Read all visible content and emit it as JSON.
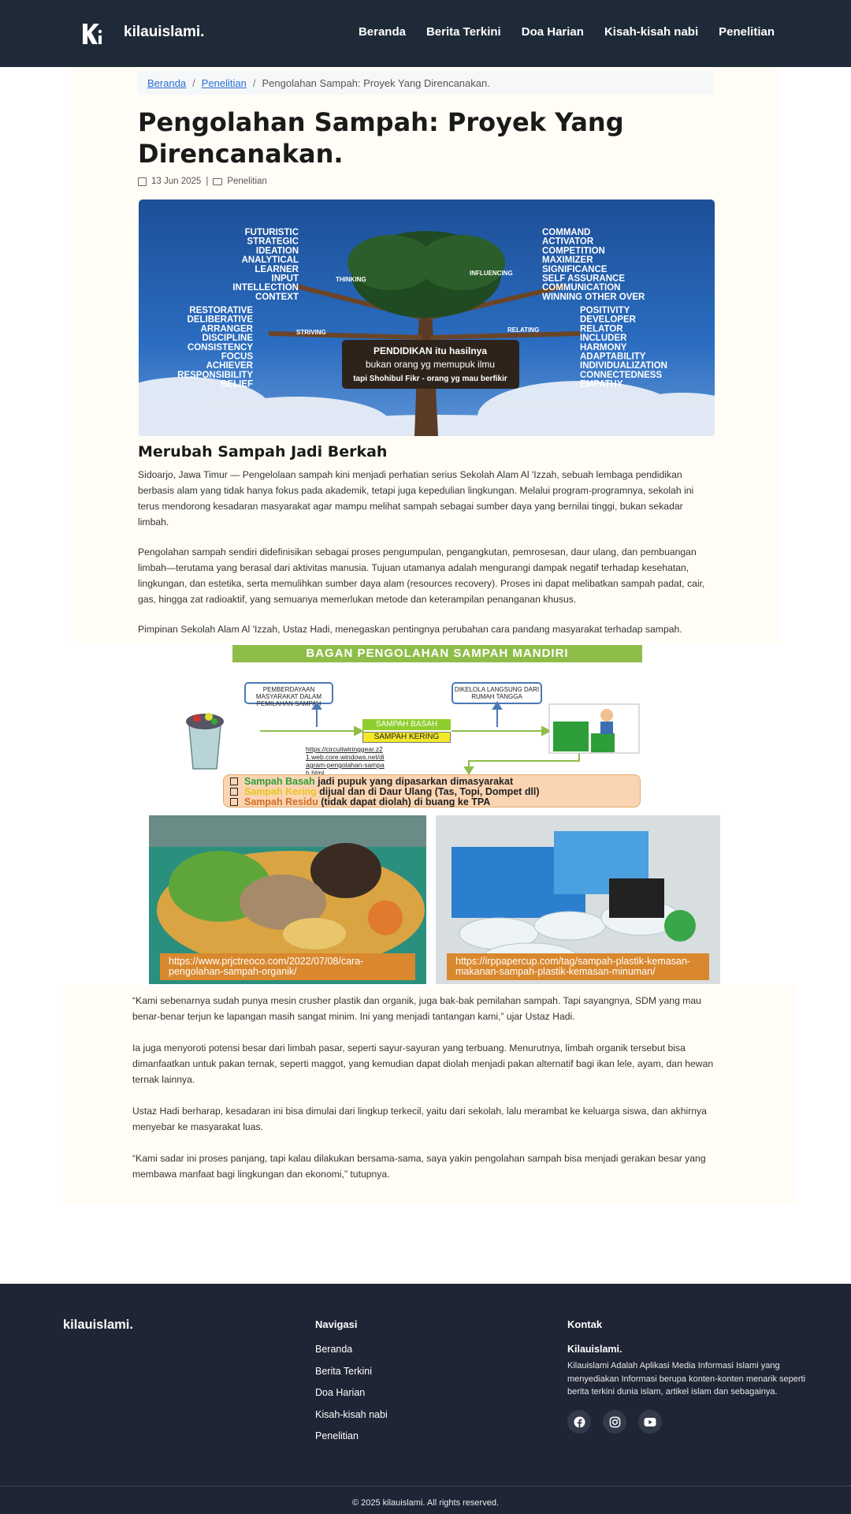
{
  "header": {
    "brand": "kilauislami.",
    "nav": [
      "Beranda",
      "Berita Terkini",
      "Doa Harian",
      "Kisah-kisah nabi",
      "Penelitian"
    ]
  },
  "breadcrumb": {
    "home": "Beranda",
    "category": "Penelitian",
    "current": "Pengolahan Sampah: Proyek Yang Direncanakan."
  },
  "post": {
    "title": "Pengolahan Sampah: Proyek Yang Direncanakan.",
    "date": "13 Jun 2025",
    "meta_sep": "|",
    "category": "Penelitian",
    "hero": {
      "left_words": [
        "FUTURISTIC",
        "STRATEGIC",
        "IDEATION",
        "ANALYTICAL",
        "LEARNER",
        "INPUT",
        "INTELLECTION",
        "CONTEXT"
      ],
      "left_lower_words": [
        "RESTORATIVE",
        "DELIBERATIVE",
        "ARRANGER",
        "DISCIPLINE",
        "CONSISTENCY",
        "FOCUS",
        "ACHIEVER",
        "RESPONSIBILITY",
        "BELIEF"
      ],
      "right_words": [
        "COMMAND",
        "ACTIVATOR",
        "COMPETITION",
        "MAXIMIZER",
        "SIGNIFICANCE",
        "SELF ASSURANCE",
        "COMMUNICATION",
        "WINNING OTHER OVER"
      ],
      "right_lower_words": [
        "POSITIVITY",
        "DEVELOPER",
        "RELATOR",
        "INCLUDER",
        "HARMONY",
        "ADAPTABILITY",
        "INDIVIDUALIZATION",
        "CONNECTEDNESS",
        "EMPATHY"
      ],
      "branch_labels": [
        "THINKING",
        "INFLUENCING",
        "STRIVING",
        "RELATING"
      ],
      "sign_lines": [
        "PENDIDIKAN itu hasilnya",
        "bukan orang yg memupuk ilmu",
        "tapi Shohibul Fikr - orang yg mau berfikir"
      ]
    },
    "section_heading": "Merubah Sampah Jadi Berkah",
    "paragraphs": [
      "Sidoarjo, Jawa Timur — Pengelolaan sampah kini menjadi perhatian serius Sekolah Alam Al 'Izzah, sebuah lembaga pendidikan berbasis alam yang tidak hanya fokus pada akademik, tetapi juga kepedulian lingkungan. Melalui program-programnya, sekolah ini terus mendorong kesadaran masyarakat agar mampu melihat sampah sebagai sumber daya yang bernilai tinggi, bukan sekadar limbah.",
      "Pengolahan sampah sendiri didefinisikan sebagai proses pengumpulan, pengangkutan, pemrosesan, daur ulang, dan pembuangan limbah—terutama yang berasal dari aktivitas manusia. Tujuan utamanya adalah mengurangi dampak negatif terhadap kesehatan, lingkungan, dan estetika, serta memulihkan sumber daya alam (resources recovery). Proses ini dapat melibatkan sampah padat, cair, gas, hingga zat radioaktif, yang semuanya memerlukan metode dan keterampilan penanganan khusus.",
      "Pimpinan Sekolah Alam Al 'Izzah, Ustaz Hadi, menegaskan pentingnya perubahan cara pandang masyarakat terhadap sampah.",
      "“Kami sebenarnya sudah punya mesin crusher plastik dan organik, juga bak-bak pemilahan sampah. Tapi sayangnya, SDM yang mau benar-benar terjun ke lapangan masih sangat minim. Ini yang menjadi tantangan kami,” ujar Ustaz Hadi.",
      "Ia juga menyoroti potensi besar dari limbah pasar, seperti sayur-sayuran yang terbuang. Menurutnya, limbah organik tersebut bisa dimanfaatkan untuk pakan ternak, seperti maggot, yang kemudian dapat diolah menjadi pakan alternatif bagi ikan lele, ayam, dan hewan ternak lainnya.",
      "Ustaz Hadi berharap, kesadaran ini bisa dimulai dari lingkup terkecil, yaitu dari sekolah, lalu merambat ke keluarga siswa, dan akhirnya menyebar ke masyarakat luas.",
      "“Kami sadar ini proses panjang, tapi kalau dilakukan bersama-sama, saya yakin pengolahan sampah bisa menjadi gerakan besar yang membawa manfaat bagi lingkungan dan ekonomi,” tutupnya."
    ],
    "infographic": {
      "title": "BAGAN PENGOLAHAN SAMPAH MANDIRI",
      "box_left": "PEMBERDAYAAN MASYARAKAT DALAM PEMILAHAN SAMPAH",
      "box_right": "DIKELOLA LANGSUNG DARI RUMAH TANGGA",
      "basah": "SAMPAH BASAH",
      "kering": "SAMPAH KERING",
      "url": "https://circuitwiringgear.z21.web.core.windows.net/diagram-pengolahan-sampah.html",
      "list": [
        {
          "key": "Sampah Basah",
          "rest": " jadi pupuk yang dipasarkan dimasyarakat"
        },
        {
          "key": "Sampah Kering",
          "rest": " dijual dan di Daur Ulang (Tas, Topi, Dompet dll)"
        },
        {
          "key": "Sampah Residu",
          "rest": " (tidak dapat diolah) di buang ke TPA"
        }
      ],
      "caption_left": "https://www.prjctreoco.com/2022/07/08/cara-pengolahan-sampah-organik/",
      "caption_right": "https://irppapercup.com/tag/sampah-plastik-kemasan-makanan-sampah-plastik-kemasan-minuman/"
    }
  },
  "footer": {
    "brand": "kilauislami.",
    "nav_title": "Navigasi",
    "nav": [
      "Beranda",
      "Berita Terkini",
      "Doa Harian",
      "Kisah-kisah nabi",
      "Penelitian"
    ],
    "contact_title": "Kontak",
    "contact_name": "Kilauislami.",
    "contact_desc": "Kilauislami Adalah Aplikasi Media Informasi Islami yang menyediakan Informasi berupa konten-konten menarik seperti berita terkini dunia islam, artikel islam dan sebagainya.",
    "social_icons": [
      "facebook-icon",
      "instagram-icon",
      "youtube-icon"
    ],
    "copyright": "© 2025 kilauislami. All rights reserved."
  },
  "colors": {
    "header_bg": "#1f2a38",
    "footer_bg": "#1f2535",
    "link": "#2a6fd6",
    "content_bg": "#fffdf5"
  }
}
